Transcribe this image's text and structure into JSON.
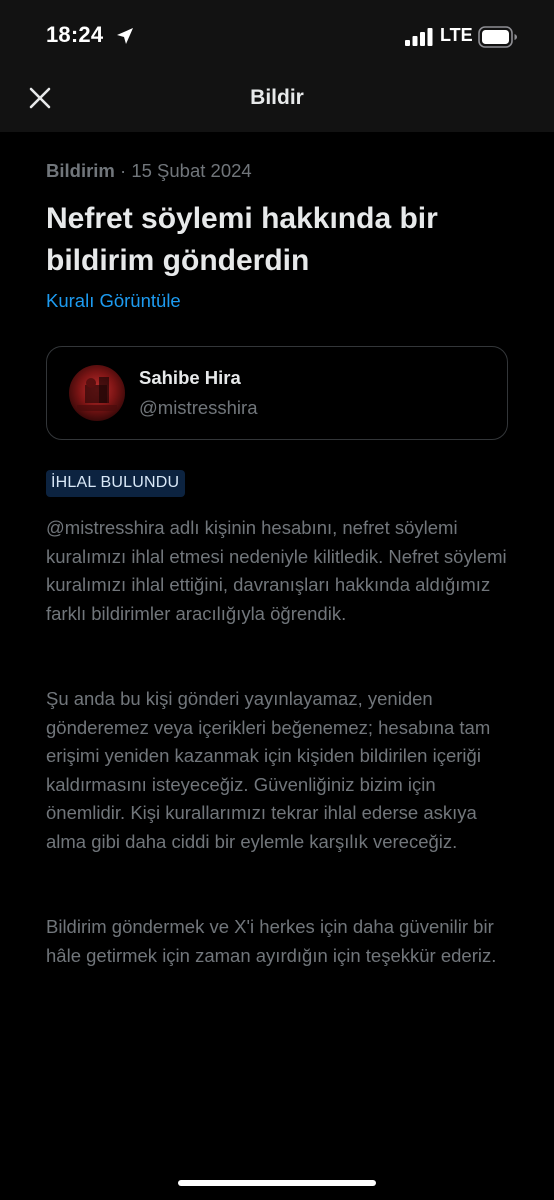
{
  "status_bar": {
    "time": "18:24",
    "network": "LTE",
    "icons": [
      "location-arrow-icon",
      "signal-icon",
      "battery-icon"
    ]
  },
  "nav": {
    "title": "Bildir",
    "close_icon": "close-icon"
  },
  "notice": {
    "type": "Bildirim",
    "separator": " · ",
    "date": "15 Şubat 2024",
    "headline": "Nefret söylemi hakkında bir bildirim gönderdin",
    "rule_link": "Kuralı Görüntüle"
  },
  "account": {
    "name": "Sahibe Hira",
    "handle": "@mistresshira"
  },
  "badge": {
    "label": "İHLAL BULUNDU"
  },
  "body": {
    "paragraph_1": "@mistresshira adlı kişinin hesabını, nefret söylemi kuralımızı ihlal etmesi nedeniyle kilitledik. Nefret söylemi kuralımızı ihlal ettiğini, davranışları hakkında aldığımız farklı bildirimler aracılığıyla öğrendik.",
    "paragraph_2": "Şu anda bu kişi gönderi yayınlayamaz, yeniden gönderemez veya içerikleri beğenemez; hesabına tam erişimi yeniden kazanmak için kişiden bildirilen içeriği kaldırmasını isteyeceğiz. Güvenliğiniz bizim için önemlidir. Kişi kurallarımızı tekrar ihlal ederse askıya alma gibi daha ciddi bir eylemle karşılık vereceğiz.",
    "paragraph_3": "Bildirim göndermek ve X'i herkes için daha güvenilir bir hâle getirmek için zaman ayırdığın için teşekkür ederiz."
  },
  "colors": {
    "background": "#000000",
    "header_bg": "#121212",
    "primary_text": "#e7e9ea",
    "secondary_text": "#71767b",
    "link": "#1d9bf0",
    "badge_bg": "#0c2340"
  }
}
